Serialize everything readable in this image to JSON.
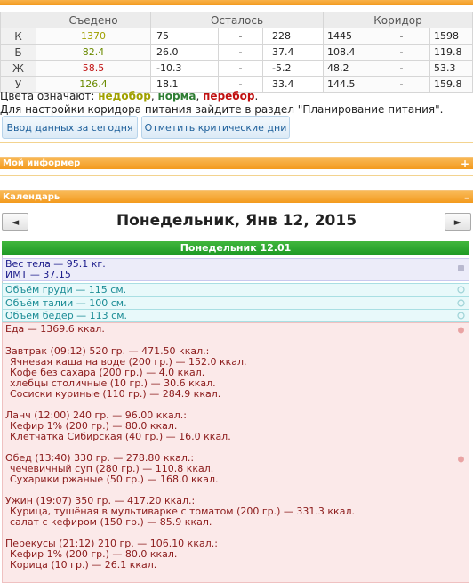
{
  "corridor_table": {
    "headers": {
      "eaten": "Съедено",
      "remaining": "Осталось",
      "corridor": "Коридор"
    },
    "rows": [
      {
        "label": "К",
        "eaten": "1370",
        "rem_from": "75",
        "rem_to": "228",
        "corr_from": "1445",
        "corr_to": "1598",
        "status": "under"
      },
      {
        "label": "Б",
        "eaten": "82.4",
        "rem_from": "26.0",
        "rem_to": "37.4",
        "corr_from": "108.4",
        "corr_to": "119.8",
        "status": "norm"
      },
      {
        "label": "Ж",
        "eaten": "58.5",
        "rem_from": "-10.3",
        "rem_to": "-5.2",
        "corr_from": "48.2",
        "corr_to": "53.3",
        "status": "over"
      },
      {
        "label": "У",
        "eaten": "126.4",
        "rem_from": "18.1",
        "rem_to": "33.4",
        "corr_from": "144.5",
        "corr_to": "159.8",
        "status": "under"
      }
    ],
    "dash": "-"
  },
  "legend": {
    "prefix": "Цвета означают: ",
    "under": "недобор",
    "sep1": ", ",
    "norm": "норма",
    "sep2": ", ",
    "over": "перебор",
    "suffix": "."
  },
  "hint": "Для настройки коридора питания зайдите в раздел \"Планирование питания\".",
  "buttons": {
    "enter_today": "Ввод данных за сегодня",
    "mark_critical": "Отметить критические дни"
  },
  "panels": {
    "informer": {
      "title": "Мой информер",
      "toggle": "+"
    },
    "calendar": {
      "title": "Календарь",
      "toggle": "–"
    }
  },
  "calendar": {
    "prev": "◄",
    "next": "►",
    "date_title": "Понедельник, Янв 12, 2015",
    "day_header": "Понедельник 12.01",
    "weight_line": "Вес тела — 95.1 кг.",
    "bmi_line": "ИМТ — 37.15",
    "measurements": [
      "Объём груди — 115 см.",
      "Объём талии — 100 см.",
      "Объём бёдер — 113 см."
    ],
    "food_total": "Еда — 1369.6 ккал.",
    "meals": [
      {
        "title": "Завтрак (09:12) 520 гр. — 471.50 ккал.:",
        "items": [
          "Ячневая каша на воде (200 гр.) — 152.0 ккал.",
          "Кофе без сахара (200 гр.) — 4.0 ккал.",
          "хлебцы столичные (10 гр.) — 30.6 ккал.",
          "Сосиски куриные (110 гр.) — 284.9 ккал."
        ]
      },
      {
        "title": "Ланч (12:00) 240 гр. — 96.00 ккал.:",
        "items": [
          "Кефир 1% (200 гр.) — 80.0 ккал.",
          "Клетчатка Сибирская (40 гр.) — 16.0 ккал."
        ]
      },
      {
        "title": "Обед (13:40) 330 гр. — 278.80 ккал.:",
        "items": [
          "чечевичный суп (280 гр.) — 110.8 ккал.",
          "Сухарики ржаные (50 гр.) — 168.0 ккал."
        ]
      },
      {
        "title": "Ужин (19:07) 350 гр. — 417.20 ккал.:",
        "items": [
          "Курица, тушёная в мультиварке с томатом (200 гр.) — 331.3 ккал.",
          "салат с кефиром (150 гр.) — 85.9 ккал."
        ]
      },
      {
        "title": "Перекусы (21:12) 210 гр. — 106.10 ккал.:",
        "items": [
          "Кефир 1% (200 гр.) — 80.0 ккал.",
          "Корица (10 гр.) — 26.1 ккал."
        ]
      }
    ]
  },
  "colors": {
    "under": "#a0a000",
    "norm": "#6a8a00",
    "over": "#c01010",
    "accent": "#f39a1e",
    "day_header": "#1f9a26"
  }
}
